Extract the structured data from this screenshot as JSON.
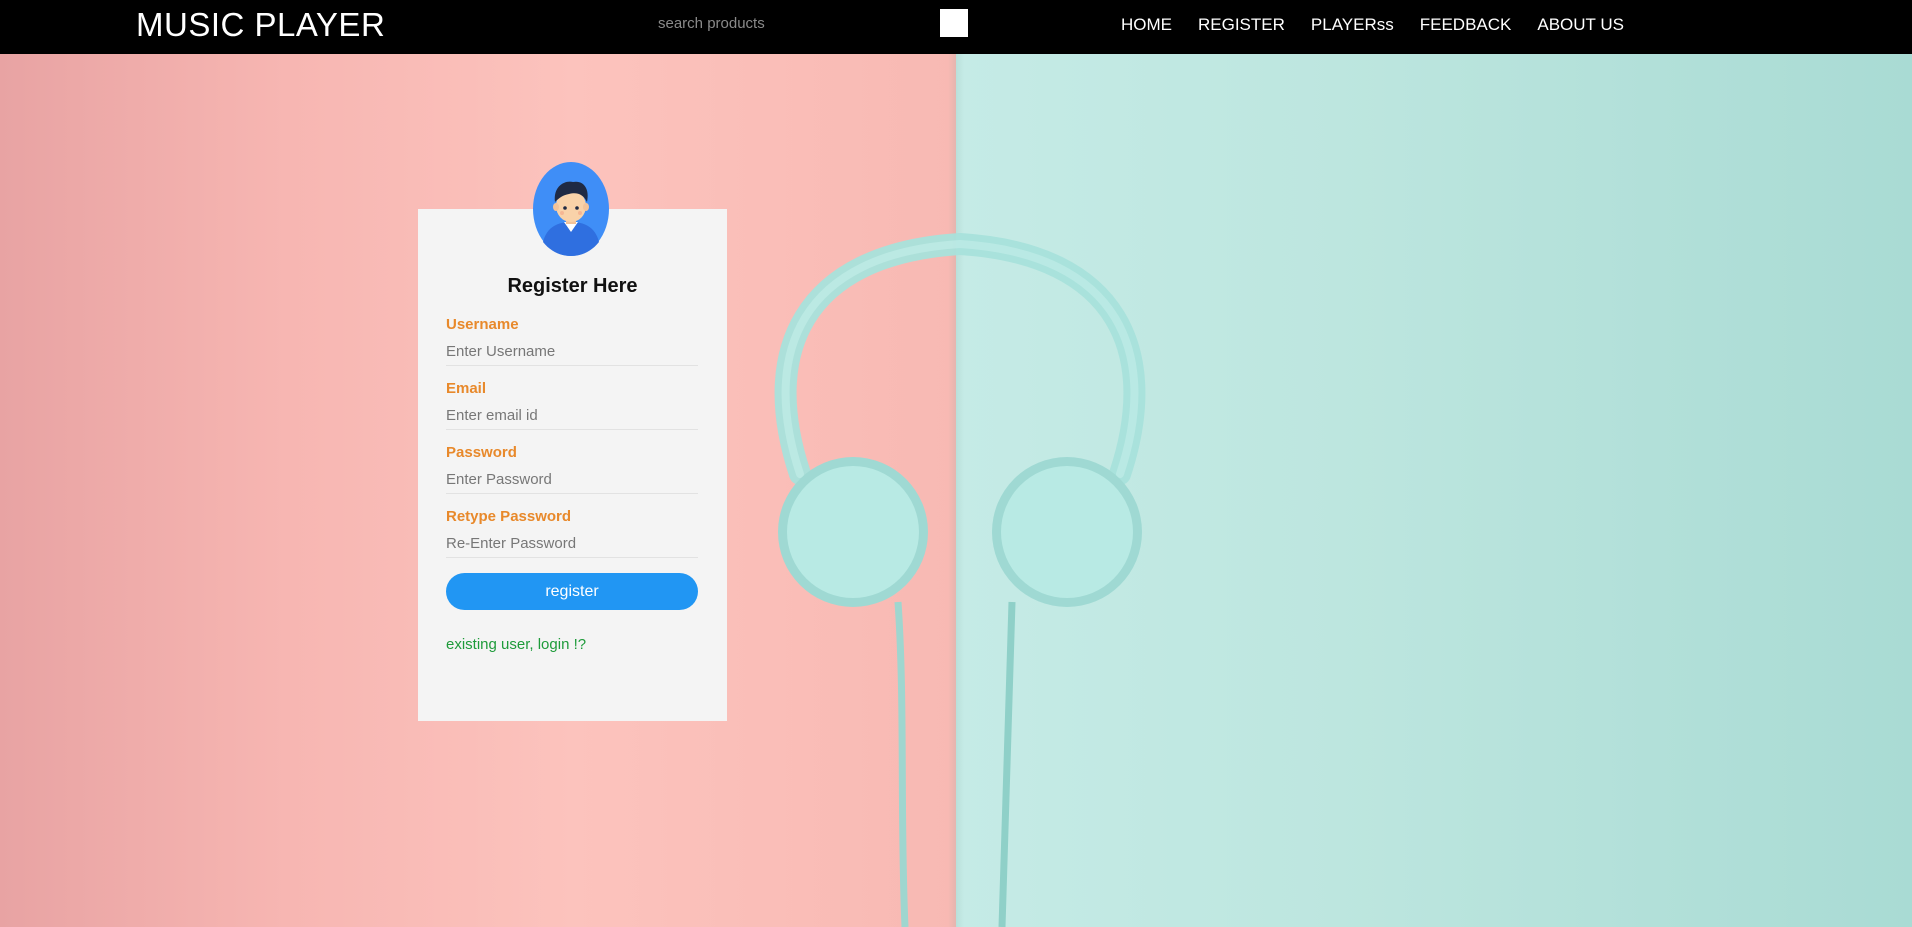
{
  "navbar": {
    "brand": "MUSIC PLAYER",
    "search_placeholder": "search products",
    "links": [
      "HOME",
      "REGISTER",
      "PLAYERss",
      "FEEDBACK",
      "ABOUT US"
    ]
  },
  "background": {
    "left_color": "#f7b6b2",
    "right_color": "#bde6df",
    "headphones_color": "#a8e1db",
    "image": "headphones-icon"
  },
  "form": {
    "title": "Register Here",
    "avatar": "user-avatar-icon",
    "fields": [
      {
        "label": "Username",
        "placeholder": "Enter Username"
      },
      {
        "label": "Email",
        "placeholder": "Enter email id"
      },
      {
        "label": "Password",
        "placeholder": "Enter Password"
      },
      {
        "label": "Retype Password",
        "placeholder": "Re-Enter Password"
      }
    ],
    "submit_label": "register",
    "login_link": "existing user, login !?"
  },
  "colors": {
    "navbar_bg": "#000000",
    "label": "#e8892b",
    "button": "#2196f3",
    "link": "#1e9b3a",
    "card_bg": "#f4f4f4"
  }
}
